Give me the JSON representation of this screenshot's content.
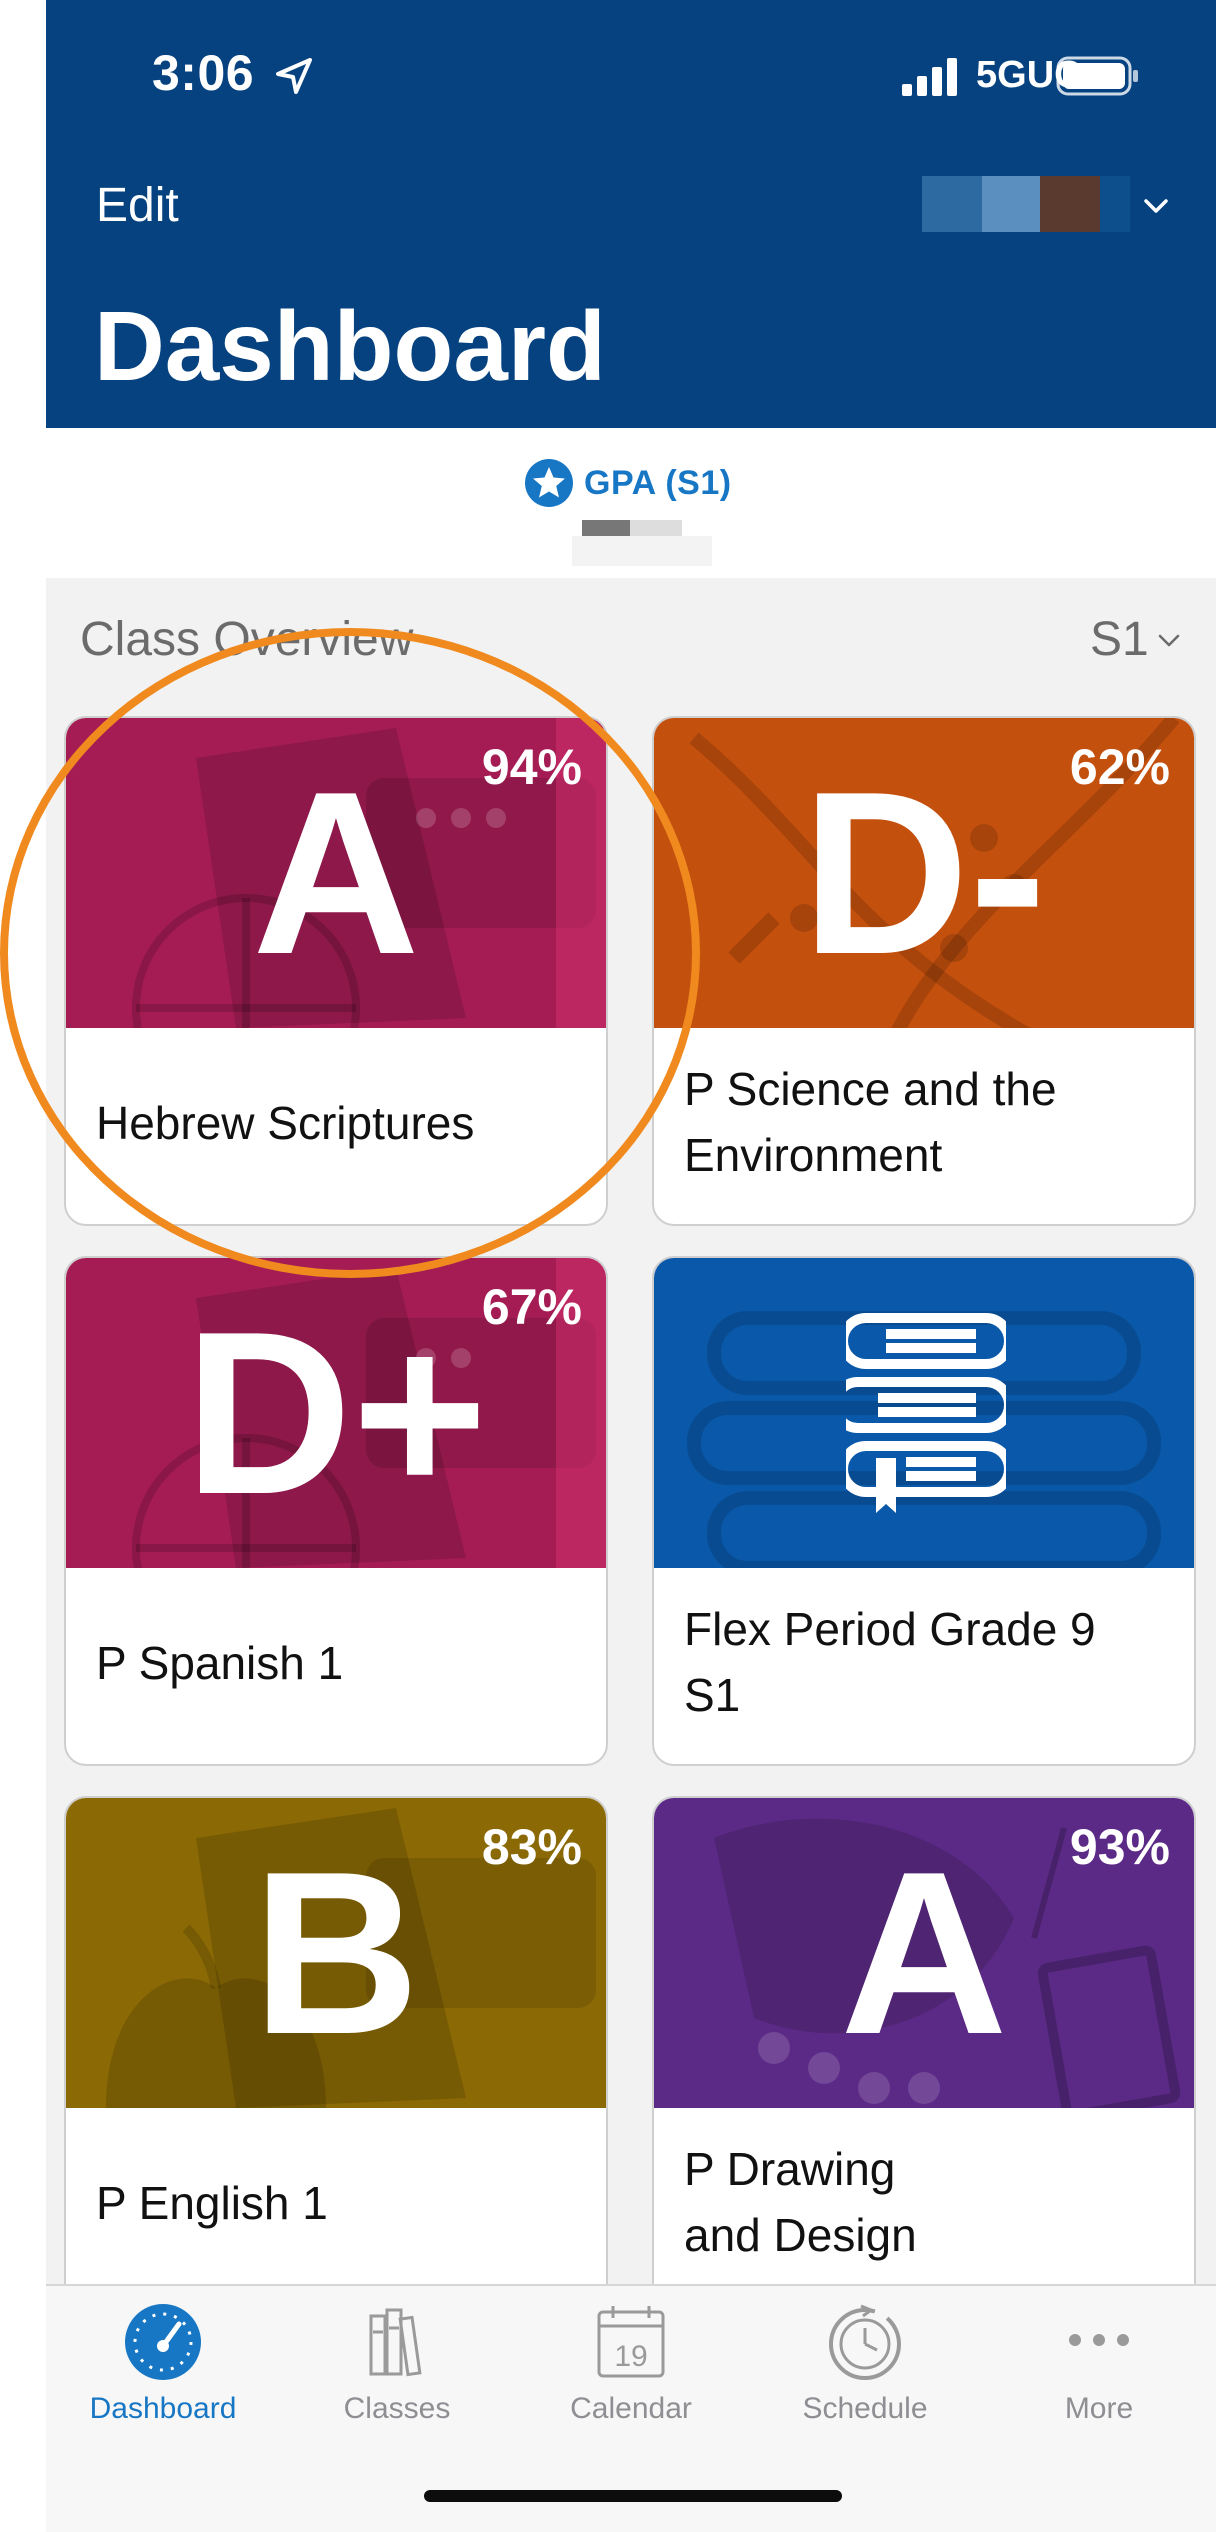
{
  "status_bar": {
    "time": "3:06",
    "network": "5GUC"
  },
  "header": {
    "edit_label": "Edit",
    "title": "Dashboard"
  },
  "gpa": {
    "label": "GPA (S1)"
  },
  "overview": {
    "title": "Class Overview",
    "term": "S1",
    "classes": [
      {
        "name": "Hebrew Scriptures",
        "grade": "A",
        "percent": "94%",
        "color": "#a51c55"
      },
      {
        "name": "P Science and the Environment",
        "grade": "D-",
        "percent": "62%",
        "color": "#c4500e"
      },
      {
        "name": "P Spanish 1",
        "grade": "D+",
        "percent": "67%",
        "color": "#a51c55"
      },
      {
        "name": "Flex Period Grade 9 S1",
        "grade": "",
        "percent": "",
        "color": "#0a58a9",
        "icon": "books-icon"
      },
      {
        "name": "P English 1",
        "grade": "B",
        "percent": "83%",
        "color": "#8b6a05"
      },
      {
        "name": "P Drawing and Design",
        "grade": "A",
        "percent": "93%",
        "color": "#5b2a86"
      }
    ]
  },
  "tabs": [
    {
      "label": "Dashboard",
      "icon": "speedometer-icon",
      "active": true
    },
    {
      "label": "Classes",
      "icon": "books-icon",
      "active": false
    },
    {
      "label": "Calendar",
      "icon": "calendar-icon",
      "active": false,
      "day": "19"
    },
    {
      "label": "Schedule",
      "icon": "clock-icon",
      "active": false
    },
    {
      "label": "More",
      "icon": "ellipsis-icon",
      "active": false
    }
  ],
  "colors": {
    "header": "#05427f",
    "accent": "#1777c4",
    "highlight": "#f08a1e"
  }
}
